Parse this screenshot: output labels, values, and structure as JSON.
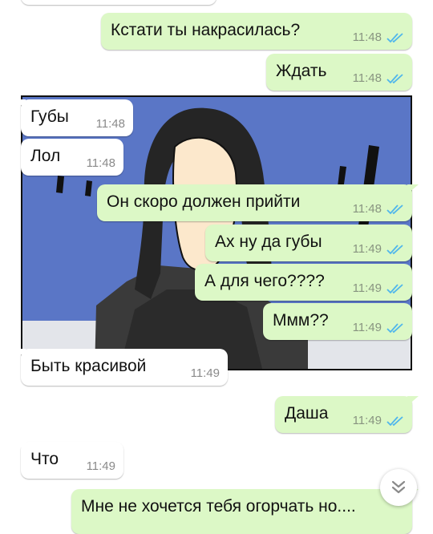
{
  "messages": [
    {
      "text": "Кстати ты накрасилась?",
      "time": "11:48",
      "dir": "out"
    },
    {
      "text": "Ждать",
      "time": "11:48",
      "dir": "out"
    },
    {
      "text": "Губы",
      "time": "11:48",
      "dir": "in"
    },
    {
      "text": "Лол",
      "time": "11:48",
      "dir": "in"
    },
    {
      "text": "Он скоро должен прийти",
      "time": "11:48",
      "dir": "out"
    },
    {
      "text": "Ах ну да губы",
      "time": "11:49",
      "dir": "out"
    },
    {
      "text": "А для чего????",
      "time": "11:49",
      "dir": "out"
    },
    {
      "text": "Ммм??",
      "time": "11:49",
      "dir": "out"
    },
    {
      "text": "Быть красивой",
      "time": "11:49",
      "dir": "in"
    },
    {
      "text": "Даша",
      "time": "11:49",
      "dir": "out"
    },
    {
      "text": "Что",
      "time": "11:49",
      "dir": "in"
    },
    {
      "text": "Мне не хочется тебя огорчать но....",
      "time": "",
      "dir": "out"
    }
  ],
  "icons": {
    "read_receipt": "double-check-icon",
    "scroll_down": "double-chevron-down-icon"
  },
  "colors": {
    "outgoing_bubble": "#dcf8c6",
    "incoming_bubble": "#ffffff",
    "read_ticks": "#4fb6ec",
    "wallpaper": "#5a76c6"
  }
}
